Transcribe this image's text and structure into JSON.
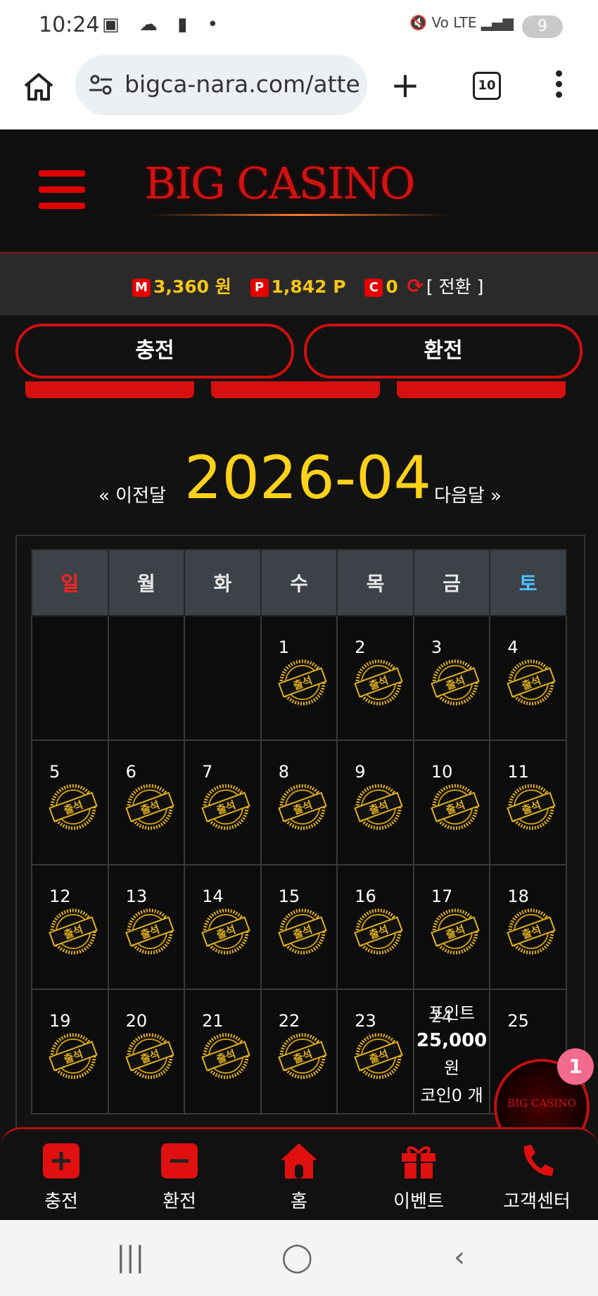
{
  "status_bar": {
    "time": "10:24",
    "left_icons": "▣ ☁ ▮ •",
    "right_icons": "🔇 Vo LTE ▂▄▆",
    "battery": "9"
  },
  "browser": {
    "url": "bigca-nara.com/atte",
    "tab_count": "10"
  },
  "header": {
    "logo_text": "BIG CASINO",
    "logo_color": "#d11212"
  },
  "balance": {
    "money_badge": "M",
    "money_value": "3,360 원",
    "point_badge": "P",
    "point_value": "1,842 P",
    "coin_badge": "C",
    "coin_value": "0",
    "convert_label": "[ 전환 ]"
  },
  "action_buttons": {
    "charge": "충전",
    "exchange": "환전"
  },
  "calendar": {
    "prev_label": "« 이전달",
    "month": "2026-04",
    "next_label": "다음달 »",
    "weekdays": [
      "일",
      "월",
      "화",
      "수",
      "목",
      "금",
      "토"
    ],
    "weeks": [
      [
        null,
        null,
        null,
        "1",
        "2",
        "3",
        "4"
      ],
      [
        "5",
        "6",
        "7",
        "8",
        "9",
        "10",
        "11"
      ],
      [
        "12",
        "13",
        "14",
        "15",
        "16",
        "17",
        "18"
      ],
      [
        "19",
        "20",
        "21",
        "22",
        "23",
        "24",
        "25"
      ]
    ],
    "stamp_label": "출석",
    "today_info": {
      "line1": "포인트",
      "line2": "25,000",
      "line3": "원",
      "line4": "코인0 개"
    }
  },
  "bottom_nav": [
    {
      "label": "충전",
      "icon": "plus-square-icon"
    },
    {
      "label": "환전",
      "icon": "minus-square-icon"
    },
    {
      "label": "홈",
      "icon": "home-icon"
    },
    {
      "label": "이벤트",
      "icon": "gift-icon"
    },
    {
      "label": "고객센터",
      "icon": "phone-24-icon"
    }
  ],
  "float": {
    "logo_text": "BIG CASINO",
    "badge_count": "1"
  },
  "android_nav": {
    "recent": "|||",
    "home": "◯",
    "back": "‹"
  },
  "colors": {
    "accent_red": "#d10e0e",
    "gold": "#ffd21a",
    "saturday_blue": "#4dc3ff",
    "sunday_red": "#ff2222"
  }
}
